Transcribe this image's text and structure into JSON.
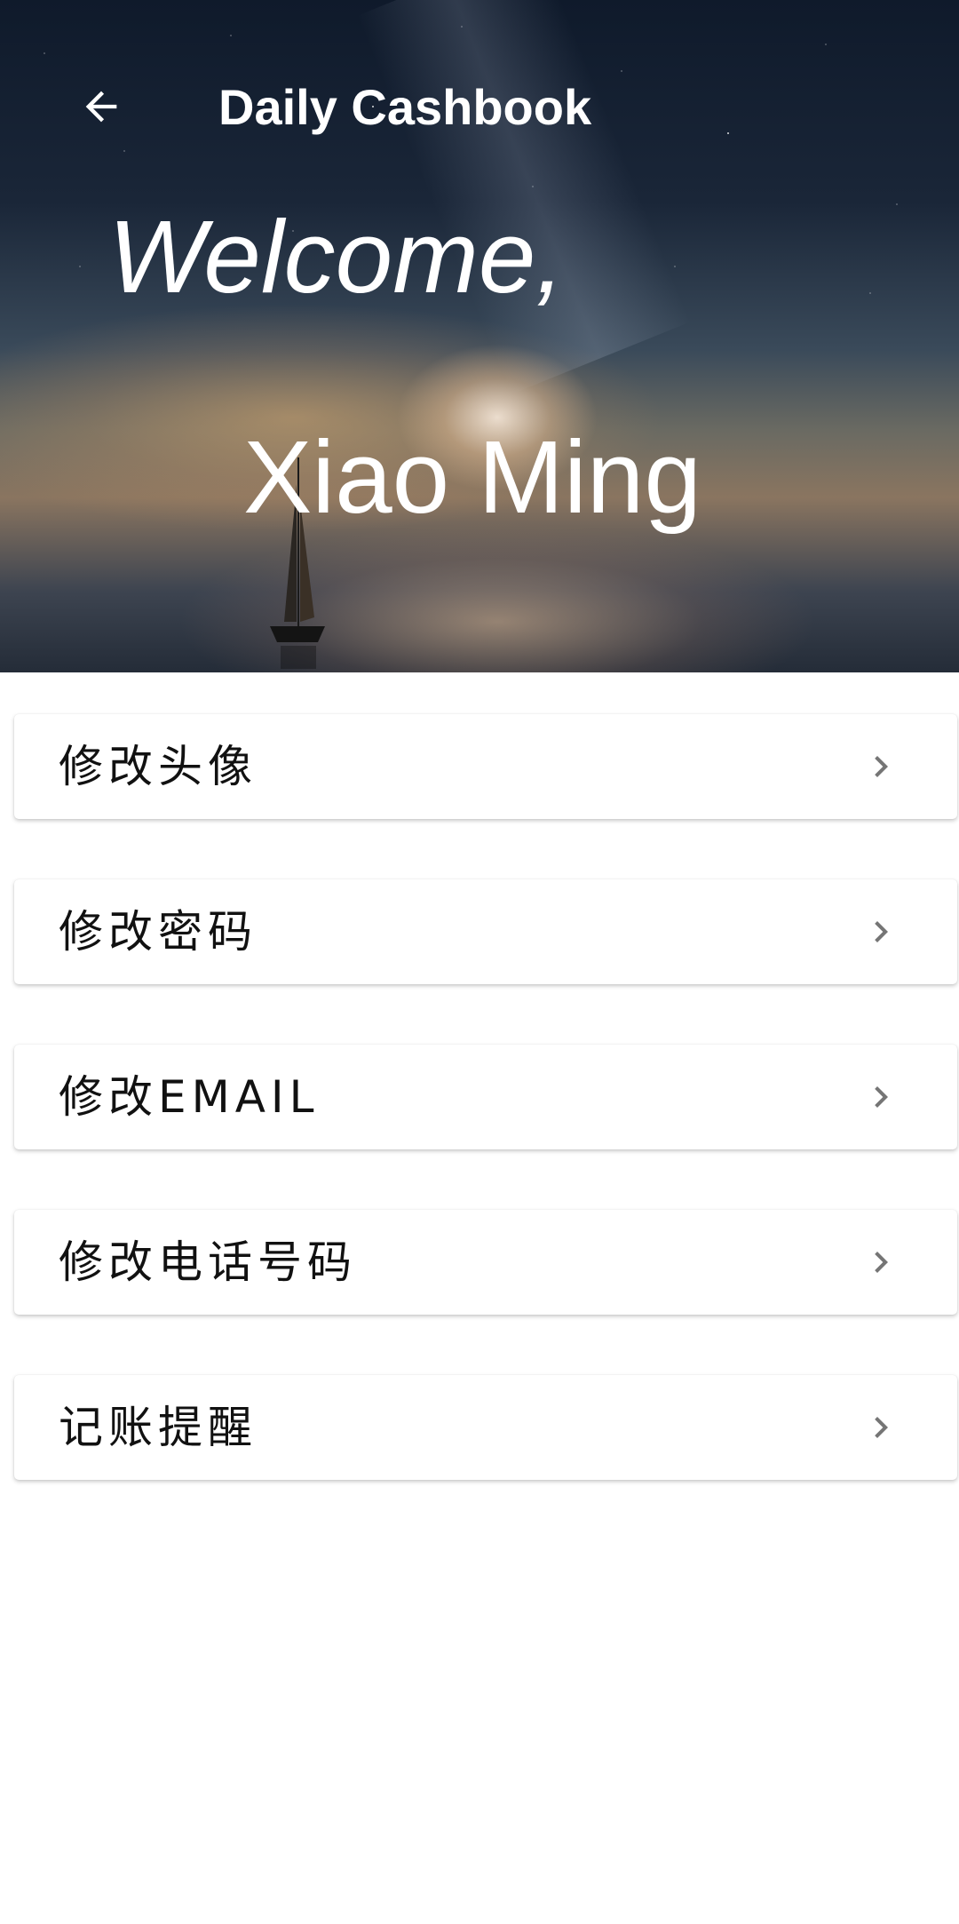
{
  "header": {
    "back_icon": "arrow-left-icon",
    "app_title": "Daily Cashbook",
    "welcome_text": "Welcome,",
    "username": "Xiao Ming"
  },
  "menu": {
    "items": [
      {
        "label": "修改头像",
        "icon": "chevron-right-icon"
      },
      {
        "label": "修改密码",
        "icon": "chevron-right-icon"
      },
      {
        "label": "修改EMAIL",
        "icon": "chevron-right-icon"
      },
      {
        "label": "修改电话号码",
        "icon": "chevron-right-icon"
      },
      {
        "label": "记账提醒",
        "icon": "chevron-right-icon"
      }
    ]
  },
  "colors": {
    "header_text": "#ffffff",
    "item_text": "#111111",
    "chevron": "#757575",
    "background": "#ffffff"
  }
}
